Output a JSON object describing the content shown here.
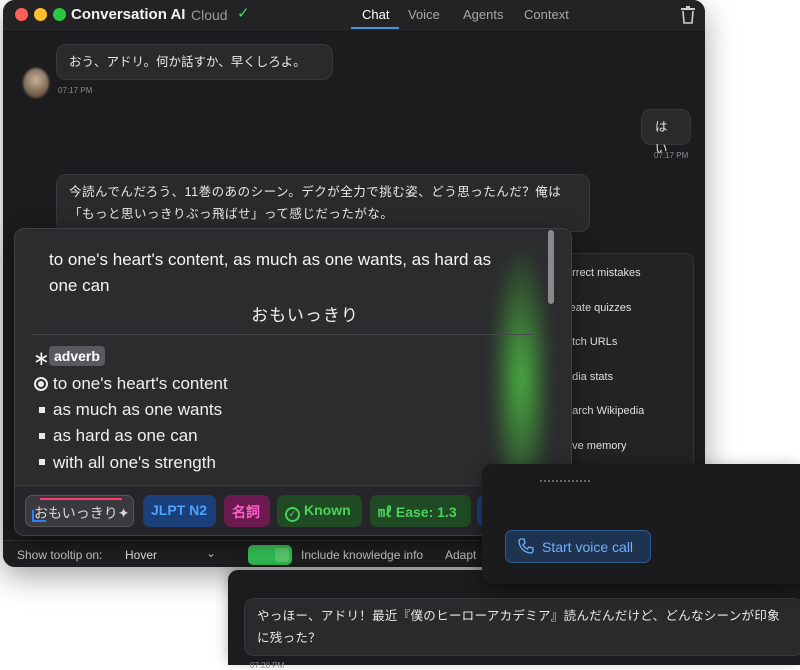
{
  "window": {
    "title": "Conversation AI",
    "sync_status": "Cloud",
    "sync_icon": "checkmark-icon",
    "tabs": [
      {
        "label": "Chat",
        "active": true
      },
      {
        "label": "Voice",
        "active": false
      },
      {
        "label": "Agents",
        "active": false
      },
      {
        "label": "Context",
        "active": false
      }
    ]
  },
  "messages": [
    {
      "role": "assistant",
      "text": "おう、アドリ。何か話すか、早くしろよ。",
      "time": "07:17 PM"
    },
    {
      "role": "user",
      "text": "はい",
      "time": "07:17 PM"
    },
    {
      "role": "assistant",
      "text": "今読んでんだろう、11巻のあのシーン。デクが全力で挑む姿、どう思ったんだ？俺は「もっと思いっきりぶっ飛ばせ」って感じだったがな。"
    }
  ],
  "capabilities": [
    "orrect mistakes",
    "reate quizzes",
    "etch URLs",
    "edia stats",
    "earch Wikipedia",
    "ave memory"
  ],
  "tooltip": {
    "definition": "to one's heart's content, as much as one wants, as hard as one can",
    "reading": "おもいっきり",
    "part_of_speech": "adverb",
    "senses": [
      "to one's heart's content",
      "as much as one wants",
      "as hard as one can",
      "with all one's strength"
    ],
    "chips": {
      "word": "おもいっきり✦",
      "jlpt": "JLPT N2",
      "pos": "名詞",
      "known": "Known",
      "ease": "㎖ Ease: 1.3"
    }
  },
  "settings": {
    "show_tooltip_label": "Show tooltip on:",
    "show_tooltip_value": "Hover",
    "include_knowledge_label": "Include knowledge info",
    "include_knowledge_on": true,
    "adapt_label": "Adapt"
  },
  "voice": {
    "start_button": "Start voice call"
  },
  "second_window": {
    "message": "やっほー、アドリ！最近『僕のヒーローアカデミア』読んだんだけど、どんなシーンが印象に残った？",
    "time": "07:20 PM"
  },
  "colors": {
    "accent": "#4a90e2",
    "known_green": "#49d35a",
    "jlpt_blue": "#4aa3ff",
    "pos_pink": "#ff5fc8",
    "toggle_green": "#35c759"
  }
}
